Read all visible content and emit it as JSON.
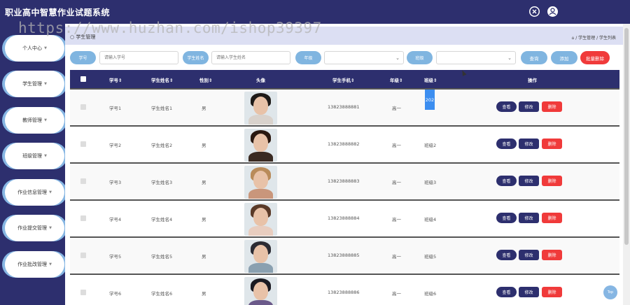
{
  "app": {
    "title": "职业高中智慧作业试题系统"
  },
  "watermark": "https://www.huzhan.com/ishop39397",
  "sidebar": {
    "items": [
      {
        "label": "个人中心"
      },
      {
        "label": "学生管理"
      },
      {
        "label": "教师管理"
      },
      {
        "label": "班级管理"
      },
      {
        "label": "作业信息管理"
      },
      {
        "label": "作业提交管理"
      },
      {
        "label": "作业批改管理"
      }
    ]
  },
  "breadcrumb": {
    "left": "学生管理",
    "home": "⌂",
    "right": "/ 学生管理 / 学生列表"
  },
  "search": {
    "student_no_label": "学号",
    "student_no_placeholder": "请输入学号",
    "student_name_label": "学生姓名",
    "student_name_placeholder": "请输入学生姓名",
    "grade_label": "年级",
    "class_label": "班级",
    "query_label": "查询",
    "add_label": "添加",
    "batch_delete_label": "批量删除"
  },
  "table": {
    "headers": {
      "no": "学号",
      "name": "学生姓名",
      "gender": "性别",
      "avatar": "头像",
      "phone": "学生手机",
      "grade": "年级",
      "class": "班级",
      "action": "操作"
    },
    "rows": [
      {
        "no": "学号1",
        "name": "学生姓名1",
        "gender": "男",
        "phone": "13823888881",
        "grade": "高一",
        "class": "202",
        "hair": "#1e1a18",
        "body": "#d9d2cc"
      },
      {
        "no": "学号2",
        "name": "学生姓名2",
        "gender": "男",
        "phone": "13823888882",
        "grade": "高一",
        "class": "班级2",
        "hair": "#2a1810",
        "body": "#3a2a22"
      },
      {
        "no": "学号3",
        "name": "学生姓名3",
        "gender": "男",
        "phone": "13823888883",
        "grade": "高一",
        "class": "班级3",
        "hair": "#b98b5a",
        "body": "#c9967b"
      },
      {
        "no": "学号4",
        "name": "学生姓名4",
        "gender": "男",
        "phone": "13823888884",
        "grade": "高一",
        "class": "班级4",
        "hair": "#5a3a28",
        "body": "#e8cdbf"
      },
      {
        "no": "学号5",
        "name": "学生姓名5",
        "gender": "男",
        "phone": "13823888885",
        "grade": "高一",
        "class": "班级5",
        "hair": "#2b2b33",
        "body": "#8aa0b0"
      },
      {
        "no": "学号6",
        "name": "学生姓名6",
        "gender": "男",
        "phone": "13823888886",
        "grade": "高一",
        "class": "班级6",
        "hair": "#1a1a22",
        "body": "#6b5a8a"
      }
    ],
    "actions": {
      "view": "查看",
      "edit": "修改",
      "delete": "删除"
    }
  },
  "top_button_label": "Top",
  "colors": {
    "primary": "#2d2f6e",
    "accent": "#80b5e0",
    "danger": "#f03a3a",
    "highlight": "#3c8ef0"
  }
}
